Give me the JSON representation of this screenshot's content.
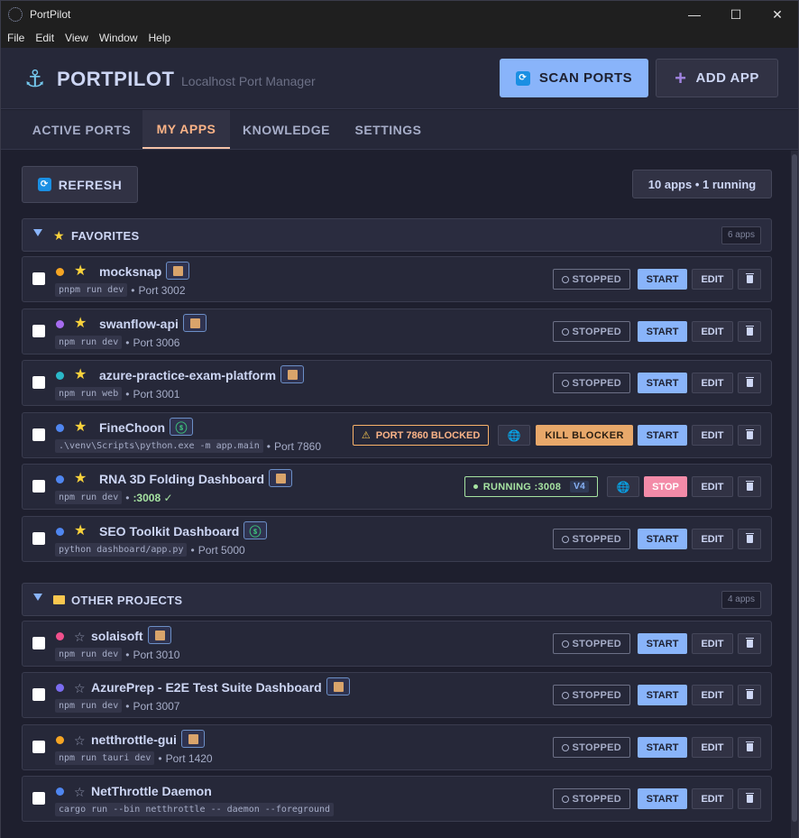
{
  "window": {
    "title": "PortPilot",
    "controls": [
      "—",
      "☐",
      "✕"
    ]
  },
  "menu": [
    "File",
    "Edit",
    "View",
    "Window",
    "Help"
  ],
  "header": {
    "brand": "PORTPILOT",
    "tagline": "Localhost Port Manager",
    "scan_label": "SCAN PORTS",
    "add_label": "ADD APP",
    "logo_icon": "anchor-icon"
  },
  "tabs": [
    {
      "label": "ACTIVE PORTS",
      "active": false
    },
    {
      "label": "MY APPS",
      "active": true
    },
    {
      "label": "KNOWLEDGE",
      "active": false
    },
    {
      "label": "SETTINGS",
      "active": false
    }
  ],
  "toolbar": {
    "refresh_label": "REFRESH",
    "summary": "10 apps • 1 running"
  },
  "labels": {
    "stopped": "STOPPED",
    "start": "START",
    "stop": "STOP",
    "edit": "EDIT",
    "kill": "KILL BLOCKER",
    "bullet": "•"
  },
  "sections": [
    {
      "name": "FAVORITES",
      "icon": "star-icon",
      "count": "6 apps",
      "apps": [
        {
          "name": "mocksnap",
          "dot": "#f5a524",
          "starred": true,
          "type": "package",
          "cmd": "pnpm run dev",
          "port": "Port 3002",
          "status": "stopped"
        },
        {
          "name": "swanflow-api",
          "dot": "#a66cf0",
          "starred": true,
          "type": "package",
          "cmd": "npm run dev",
          "port": "Port 3006",
          "status": "stopped"
        },
        {
          "name": "azure-practice-exam-platform",
          "dot": "#2bb8c9",
          "starred": true,
          "type": "package",
          "cmd": "npm run web",
          "port": "Port 3001",
          "status": "stopped"
        },
        {
          "name": "FineChoon",
          "dot": "#4f86f0",
          "starred": true,
          "type": "python",
          "cmd": ".\\venv\\Scripts\\python.exe -m app.main",
          "port": "Port 7860",
          "status": "blocked",
          "blocked_label": "PORT 7860 BLOCKED"
        },
        {
          "name": "RNA 3D Folding Dashboard",
          "dot": "#4f86f0",
          "starred": true,
          "type": "package",
          "cmd": "npm run dev",
          "port": ":3008 ✓",
          "status": "running",
          "running_label": "RUNNING :3008",
          "ip_label": "V4"
        },
        {
          "name": "SEO Toolkit Dashboard",
          "dot": "#4f86f0",
          "starred": true,
          "type": "python",
          "cmd": "python dashboard/app.py",
          "port": "Port 5000",
          "status": "stopped"
        }
      ]
    },
    {
      "name": "OTHER PROJECTS",
      "icon": "folder-icon",
      "count": "4 apps",
      "apps": [
        {
          "name": "solaisoft",
          "dot": "#f0508c",
          "starred": false,
          "type": "package",
          "cmd": "npm run dev",
          "port": "Port 3010",
          "status": "stopped"
        },
        {
          "name": "AzurePrep - E2E Test Suite Dashboard",
          "dot": "#7b6cf0",
          "starred": false,
          "type": "package",
          "cmd": "npm run dev",
          "port": "Port 3007",
          "status": "stopped"
        },
        {
          "name": "netthrottle-gui",
          "dot": "#f5a524",
          "starred": false,
          "type": "package",
          "cmd": "npm run tauri dev",
          "port": "Port 1420",
          "status": "stopped"
        },
        {
          "name": "NetThrottle Daemon",
          "dot": "#4f86f0",
          "starred": false,
          "type": "none",
          "cmd": "cargo run --bin netthrottle -- daemon --foreground",
          "port": "",
          "status": "stopped"
        }
      ]
    }
  ]
}
